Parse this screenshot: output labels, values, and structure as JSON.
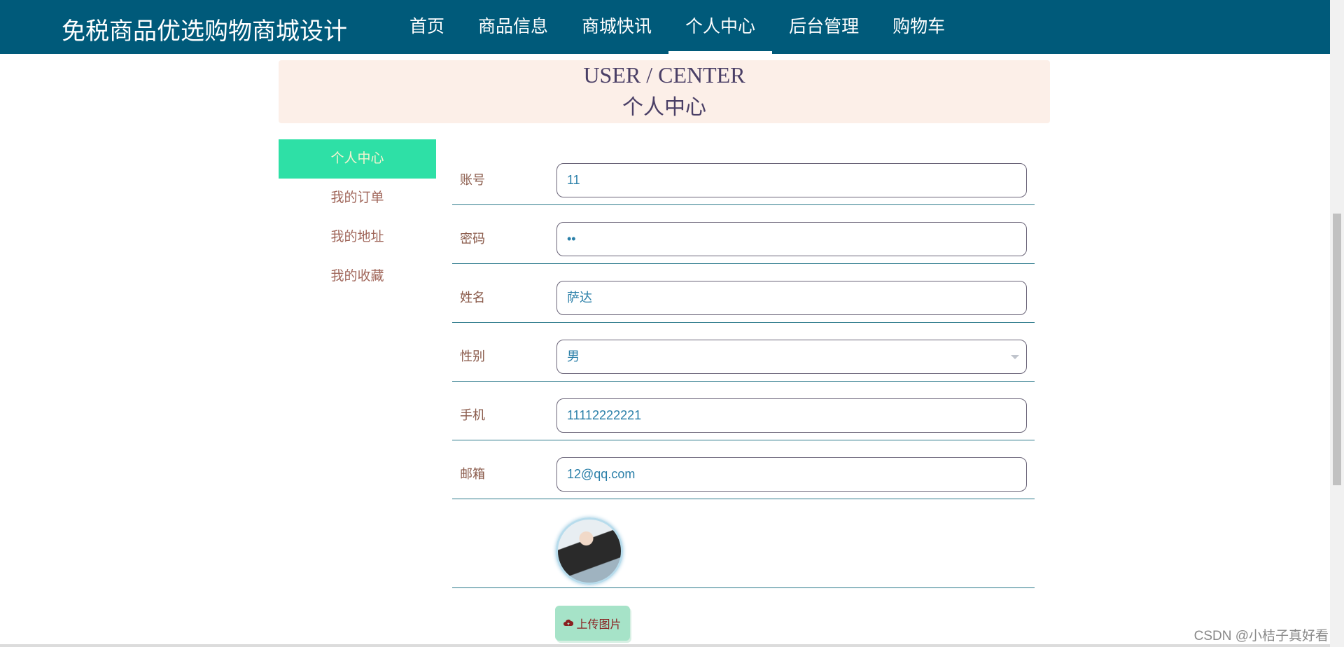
{
  "header": {
    "brand": "免税商品优选购物商城设计",
    "menu": [
      "首页",
      "商品信息",
      "商城快讯",
      "个人中心",
      "后台管理",
      "购物车"
    ],
    "active": "个人中心"
  },
  "banner": {
    "en": "USER / CENTER",
    "cn": "个人中心"
  },
  "sidebar": {
    "items": [
      "个人中心",
      "我的订单",
      "我的地址",
      "我的收藏"
    ],
    "active": "个人中心"
  },
  "form": {
    "account": {
      "label": "账号",
      "value": "11"
    },
    "password": {
      "label": "密码",
      "value": "••"
    },
    "name": {
      "label": "姓名",
      "value": "萨达"
    },
    "gender": {
      "label": "性别",
      "value": "男"
    },
    "phone": {
      "label": "手机",
      "value": "11112222221"
    },
    "email": {
      "label": "邮箱",
      "value": "12@qq.com"
    },
    "upload_label": "上传图片"
  },
  "watermark": "CSDN @小桔子真好看",
  "colors": {
    "nav": "#005a7a",
    "banner": "#fcefe8",
    "active_side": "#2ee0a6",
    "upload": "#a6e3c8"
  }
}
